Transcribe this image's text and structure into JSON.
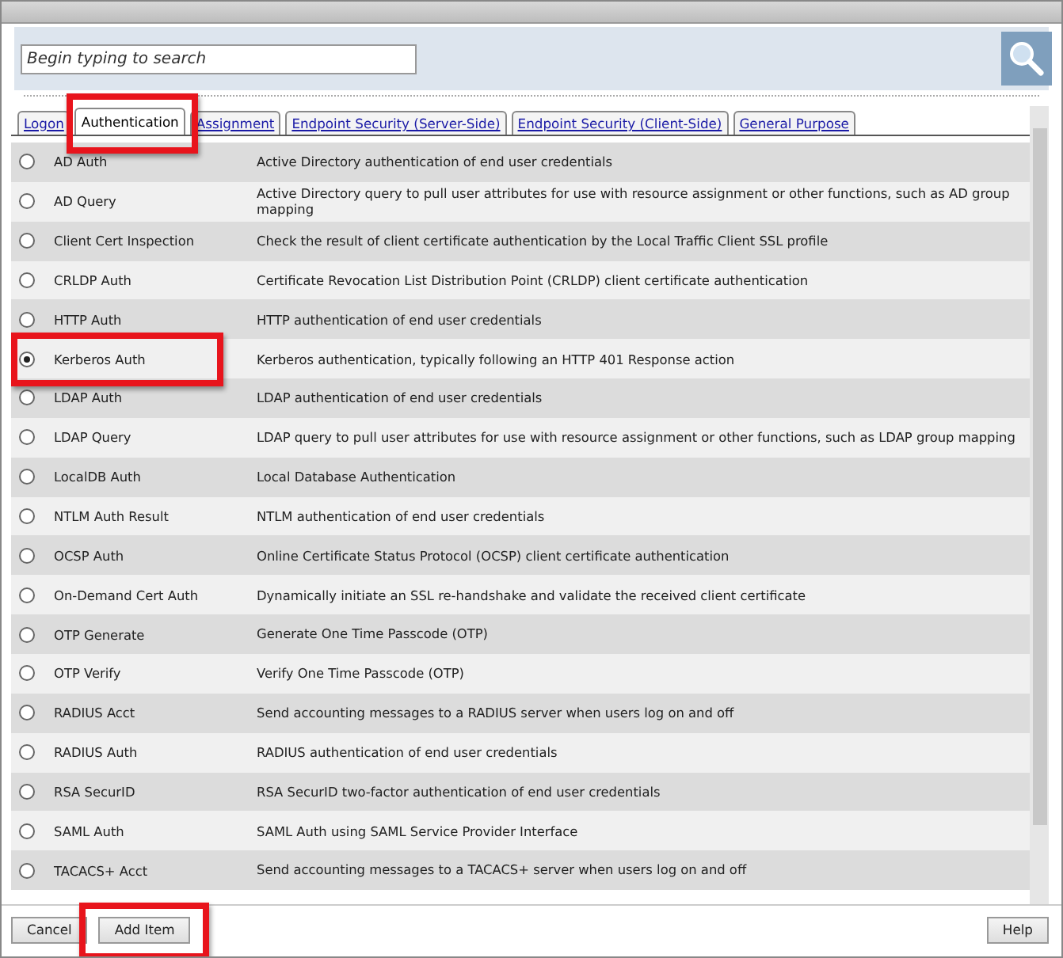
{
  "search": {
    "placeholder": "Begin typing to search"
  },
  "tabs": [
    {
      "label": "Logon",
      "selected": false,
      "highlighted": false
    },
    {
      "label": "Authentication",
      "selected": true,
      "highlighted": true
    },
    {
      "label": "Assignment",
      "selected": false,
      "highlighted": false
    },
    {
      "label": "Endpoint Security (Server-Side)",
      "selected": false,
      "highlighted": false
    },
    {
      "label": "Endpoint Security (Client-Side)",
      "selected": false,
      "highlighted": false
    },
    {
      "label": "General Purpose",
      "selected": false,
      "highlighted": false
    }
  ],
  "items": [
    {
      "name": "AD Auth",
      "description": "Active Directory authentication of end user credentials",
      "selected": false,
      "highlighted": false
    },
    {
      "name": "AD Query",
      "description": "Active Directory query to pull user attributes for use with resource assignment or other functions, such as AD group mapping",
      "selected": false,
      "highlighted": false
    },
    {
      "name": "Client Cert Inspection",
      "description": "Check the result of client certificate authentication by the Local Traffic Client SSL profile",
      "selected": false,
      "highlighted": false
    },
    {
      "name": "CRLDP Auth",
      "description": "Certificate Revocation List Distribution Point (CRLDP) client certificate authentication",
      "selected": false,
      "highlighted": false
    },
    {
      "name": "HTTP Auth",
      "description": "HTTP authentication of end user credentials",
      "selected": false,
      "highlighted": false
    },
    {
      "name": "Kerberos Auth",
      "description": "Kerberos authentication, typically following an HTTP 401 Response action",
      "selected": true,
      "highlighted": true
    },
    {
      "name": "LDAP Auth",
      "description": "LDAP authentication of end user credentials",
      "selected": false,
      "highlighted": false
    },
    {
      "name": "LDAP Query",
      "description": "LDAP query to pull user attributes for use with resource assignment or other functions, such as LDAP group mapping",
      "selected": false,
      "highlighted": false
    },
    {
      "name": "LocalDB Auth",
      "description": "Local Database Authentication",
      "selected": false,
      "highlighted": false
    },
    {
      "name": "NTLM Auth Result",
      "description": "NTLM authentication of end user credentials",
      "selected": false,
      "highlighted": false
    },
    {
      "name": "OCSP Auth",
      "description": "Online Certificate Status Protocol (OCSP) client certificate authentication",
      "selected": false,
      "highlighted": false
    },
    {
      "name": "On-Demand Cert Auth",
      "description": "Dynamically initiate an SSL re-handshake and validate the received client certificate",
      "selected": false,
      "highlighted": false
    },
    {
      "name": "OTP Generate",
      "description": "Generate One Time Passcode (OTP)",
      "selected": false,
      "highlighted": false
    },
    {
      "name": "OTP Verify",
      "description": "Verify One Time Passcode (OTP)",
      "selected": false,
      "highlighted": false
    },
    {
      "name": "RADIUS Acct",
      "description": "Send accounting messages to a RADIUS server when users log on and off",
      "selected": false,
      "highlighted": false
    },
    {
      "name": "RADIUS Auth",
      "description": "RADIUS authentication of end user credentials",
      "selected": false,
      "highlighted": false
    },
    {
      "name": "RSA SecurID",
      "description": "RSA SecurID two-factor authentication of end user credentials",
      "selected": false,
      "highlighted": false
    },
    {
      "name": "SAML Auth",
      "description": "SAML Auth using SAML Service Provider Interface",
      "selected": false,
      "highlighted": false
    },
    {
      "name": "TACACS+ Acct",
      "description": "Send accounting messages to a TACACS+ server when users log on and off",
      "selected": false,
      "highlighted": false
    }
  ],
  "buttons": [
    {
      "label": "Cancel",
      "highlighted": false
    },
    {
      "label": "Add Item",
      "highlighted": true
    }
  ],
  "help_button": {
    "label": "Help"
  }
}
